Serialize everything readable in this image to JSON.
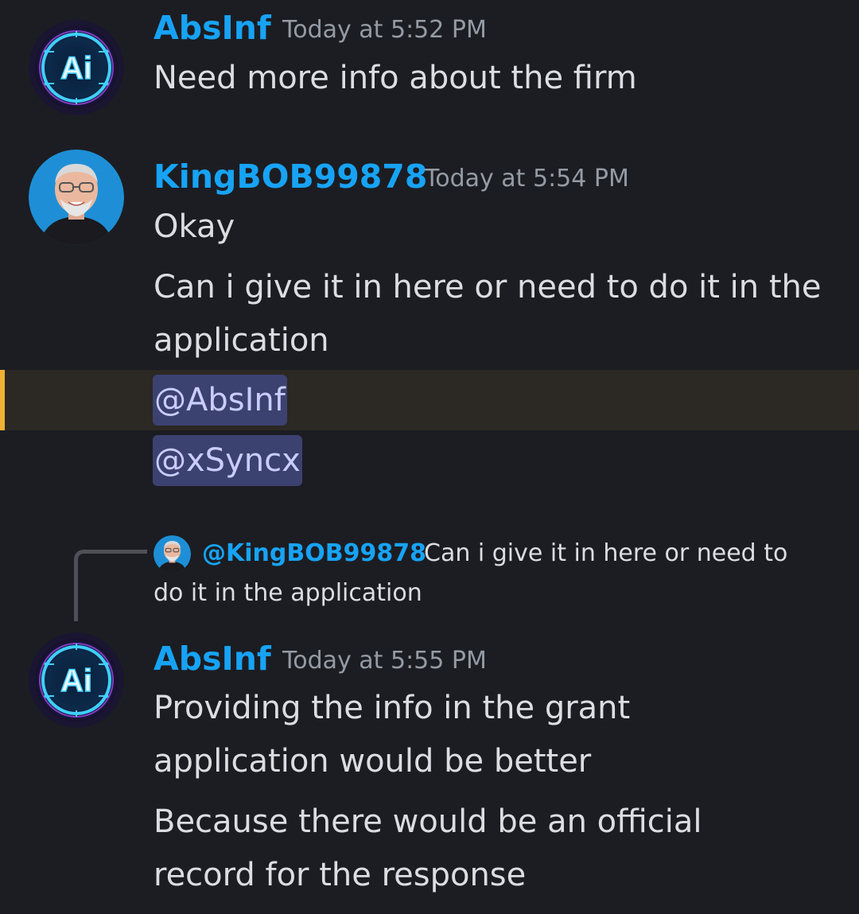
{
  "messages": [
    {
      "username": "AbsInf",
      "timestamp": "Today at 5:52 PM",
      "lines": [
        "Need more info about the firm"
      ],
      "avatar_icon": "ai-logo-icon"
    },
    {
      "username": "KingBOB99878",
      "timestamp": "Today at 5:54 PM",
      "lines": [
        "Okay",
        "Can i give it in here or need to do it in the",
        "application"
      ],
      "mentions": [
        "@AbsInf",
        "@xSyncx"
      ],
      "avatar_icon": "user-photo-avatar"
    },
    {
      "reply": {
        "username": "@KingBOB99878",
        "text_line1": "Can i give it in here or need to",
        "text_line2": "do it in the application"
      },
      "username": "AbsInf",
      "timestamp": "Today at 5:55 PM",
      "lines": [
        "Providing the info in the grant",
        "application would be better",
        "Because there would be an official",
        "record for the response"
      ],
      "avatar_icon": "ai-logo-icon"
    }
  ],
  "colors": {
    "background": "#1c1d22",
    "username": "#17a3f5",
    "timestamp": "#949ba4",
    "text": "#dbdee1",
    "mention_bg": "#3c4270",
    "mention_text": "#c9cdfb",
    "highlight_bg": "#2c2823",
    "highlight_bar": "#f0b232"
  }
}
